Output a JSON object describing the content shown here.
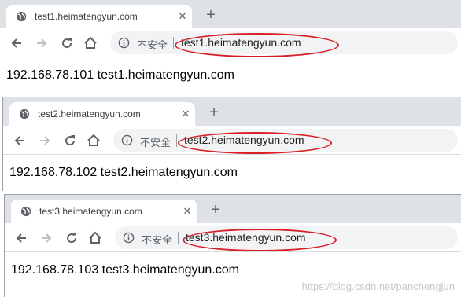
{
  "colors": {
    "tabstrip_bg": "#dee1e6",
    "omnibox_bg": "#f1f3f4",
    "annotation_oval": "#d91e26"
  },
  "icons": [
    "globe-icon",
    "close-icon",
    "plus-icon",
    "back-arrow-icon",
    "forward-arrow-icon",
    "reload-icon",
    "home-icon",
    "info-icon"
  ],
  "windows": [
    {
      "tab_title": "test1.heimatengyun.com",
      "close": "✕",
      "new_tab": "+",
      "insecure_label": "不安全",
      "url": "test1.heimatengyun.com",
      "content": "192.168.78.101 test1.heimatengyun.com"
    },
    {
      "tab_title": "test2.heimatengyun.com",
      "close": "✕",
      "new_tab": "+",
      "insecure_label": "不安全",
      "url": "test2.heimatengyun.com",
      "content": "192.168.78.102 test2.heimatengyun.com"
    },
    {
      "tab_title": "test3.heimatengyun.com",
      "close": "✕",
      "new_tab": "+",
      "insecure_label": "不安全",
      "url": "test3.heimatengyun.com",
      "content": "192.168.78.103 test3.heimatengyun.com"
    }
  ],
  "watermark": "https://blog.csdn.net/panchengjun"
}
